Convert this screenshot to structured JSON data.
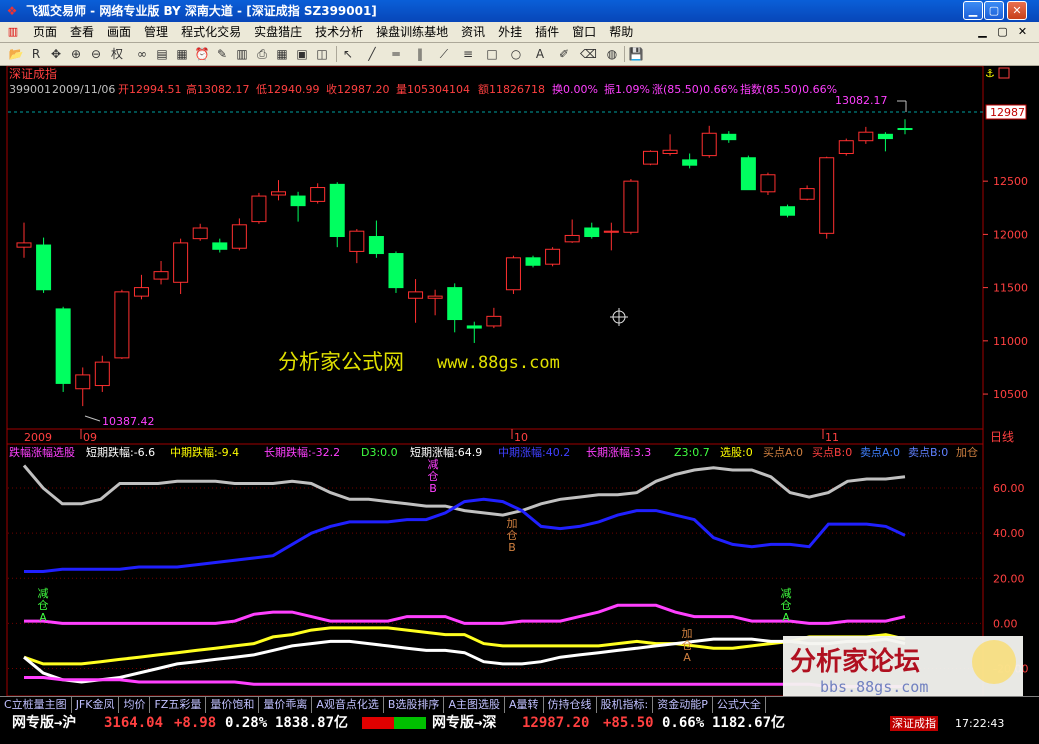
{
  "window": {
    "title": "飞狐交易师 - 网络专业版 BY 深南大道 - [深证成指 SZ399001]",
    "minimize": "▁",
    "maximize": "▢",
    "close": "✕"
  },
  "menu": [
    "页面",
    "查看",
    "画面",
    "管理",
    "程式化交易",
    "实盘猎庄",
    "技术分析",
    "操盘训练基地",
    "资讯",
    "外挂",
    "插件",
    "窗口",
    "帮助"
  ],
  "menu_window_controls": [
    "▁",
    "▢",
    "✕"
  ],
  "toolbar_icons": [
    "folder-icon",
    "rsi-icon",
    "move-icon",
    "zoom-in-icon",
    "zoom-out-icon",
    "link-icon",
    "layout-icon",
    "chart-icon",
    "alarm-icon",
    "tool-icon",
    "stats-icon",
    "print-icon",
    "grid-icon",
    "window-icon",
    "stack-icon",
    "cursor-icon",
    "line-icon",
    "hline-icon",
    "channel-icon",
    "fan-icon",
    "fib-icon",
    "rect-icon",
    "ellipse-icon",
    "text-icon",
    "brush-icon",
    "eraser-icon",
    "palette-icon",
    "save-icon"
  ],
  "toolbar": {
    "quanxuan": "权"
  },
  "price_panel": {
    "name": "深证成指",
    "info_code": "399001",
    "info_date": "2009/11/06",
    "info_open": "开12994.51",
    "info_high": "高13082.17",
    "info_low": "低12940.99",
    "info_close": "收12987.20",
    "info_vol": "量105304104",
    "info_amt": "额11826718",
    "info_turn": "换0.00%",
    "info_amp": "振1.09%",
    "info_chg": "涨(85.50)0.66%",
    "info_idx": "指数(85.50)0.66%",
    "high_label": "13082.17",
    "low_label": "10387.42",
    "current_price": "12987",
    "watermark": "分析家公式网",
    "watermark_url": "www.88gs.com",
    "x_labels": [
      "2009",
      "09",
      "10",
      "11"
    ],
    "period": "日线",
    "y_ticks": [
      "12500",
      "12000",
      "11500",
      "11000",
      "10500"
    ],
    "up_color": "#ff3030",
    "down_color": "#00ff60"
  },
  "indicator_panel": {
    "name": "跌幅涨幅选股",
    "s_drop": "短期跌幅:-6.6",
    "m_drop": "中期跌幅:-9.4",
    "l_drop": "长期跌幅:-32.2",
    "d3": "D3:0.0",
    "s_rise": "短期涨幅:64.9",
    "m_rise": "中期涨幅:40.2",
    "l_rise": "长期涨幅:3.3",
    "z3": "Z3:0.7",
    "xuangu": "选股:0",
    "sell_a": "买点A:0",
    "sell_b": "买点B:0",
    "buy_a": "卖点A:0",
    "buy_b": "卖点B:0",
    "more": "加仓",
    "y_ticks": [
      "60.00",
      "40.00",
      "20.00",
      "0.00",
      "-20.00"
    ],
    "marks": [
      {
        "text": "减仓B",
        "color": "#ff40ff"
      },
      {
        "text": "加仓B",
        "color": "#d08040"
      },
      {
        "text": "减仓A",
        "color": "#40ff40"
      },
      {
        "text": "减仓A",
        "color": "#40ff40"
      },
      {
        "text": "加仓A",
        "color": "#d08040"
      }
    ]
  },
  "ad_logo": {
    "text": "分析家论坛",
    "url": "bbs.88gs.com",
    "time": "17:22:43"
  },
  "status_tabs": [
    "C立桩量主图",
    "JFK金凤",
    "均价",
    "FZ五彩量",
    "量价饱和",
    "量价乖离",
    "A观音点化选",
    "B选股排序",
    "A主图选股",
    "A量转",
    "仿持仓线",
    "股机指标:",
    "资金动能P",
    "公式大全"
  ],
  "quotes": {
    "sh_label": "网专版→沪",
    "sh_price": "3164.04",
    "sh_chg": "+8.98",
    "sh_pct": "0.28%",
    "sh_amt": "1838.87亿",
    "sz_label": "网专版→深",
    "sz_price": "12987.20",
    "sz_chg": "+85.50",
    "sz_pct": "0.66%",
    "sz_amt": "1182.67亿",
    "current_tab": "深证成指"
  },
  "chart_data": {
    "type": "candlestick",
    "title": "深证成指",
    "ylim": [
      10200,
      13300
    ],
    "candles": [
      {
        "o": 11880,
        "c": 11920,
        "h": 12110,
        "l": 11780
      },
      {
        "o": 11900,
        "c": 11480,
        "h": 11970,
        "l": 11450
      },
      {
        "o": 11300,
        "c": 10600,
        "h": 11320,
        "l": 10520
      },
      {
        "o": 10550,
        "c": 10680,
        "h": 10750,
        "l": 10387
      },
      {
        "o": 10580,
        "c": 10800,
        "h": 10860,
        "l": 10520
      },
      {
        "o": 10840,
        "c": 11460,
        "h": 11480,
        "l": 10830
      },
      {
        "o": 11420,
        "c": 11500,
        "h": 11620,
        "l": 11390
      },
      {
        "o": 11580,
        "c": 11650,
        "h": 11750,
        "l": 11530
      },
      {
        "o": 11550,
        "c": 11920,
        "h": 11960,
        "l": 11440
      },
      {
        "o": 11960,
        "c": 12060,
        "h": 12100,
        "l": 11940
      },
      {
        "o": 11920,
        "c": 11860,
        "h": 11960,
        "l": 11830
      },
      {
        "o": 11870,
        "c": 12090,
        "h": 12150,
        "l": 11850
      },
      {
        "o": 12120,
        "c": 12360,
        "h": 12390,
        "l": 12100
      },
      {
        "o": 12370,
        "c": 12400,
        "h": 12510,
        "l": 12320
      },
      {
        "o": 12360,
        "c": 12270,
        "h": 12400,
        "l": 12120
      },
      {
        "o": 12310,
        "c": 12440,
        "h": 12480,
        "l": 12290
      },
      {
        "o": 12470,
        "c": 11980,
        "h": 12490,
        "l": 11880
      },
      {
        "o": 11840,
        "c": 12030,
        "h": 12050,
        "l": 11730
      },
      {
        "o": 11980,
        "c": 11820,
        "h": 12130,
        "l": 11780
      },
      {
        "o": 11820,
        "c": 11500,
        "h": 11840,
        "l": 11450
      },
      {
        "o": 11400,
        "c": 11460,
        "h": 11580,
        "l": 11170
      },
      {
        "o": 11400,
        "c": 11420,
        "h": 11480,
        "l": 11240
      },
      {
        "o": 11500,
        "c": 11200,
        "h": 11540,
        "l": 11080
      },
      {
        "o": 11140,
        "c": 11120,
        "h": 11180,
        "l": 10980
      },
      {
        "o": 11140,
        "c": 11230,
        "h": 11310,
        "l": 11120
      },
      {
        "o": 11480,
        "c": 11780,
        "h": 11800,
        "l": 11440
      },
      {
        "o": 11780,
        "c": 11710,
        "h": 11800,
        "l": 11690
      },
      {
        "o": 11720,
        "c": 11860,
        "h": 11880,
        "l": 11700
      },
      {
        "o": 11930,
        "c": 11990,
        "h": 12140,
        "l": 11920
      },
      {
        "o": 12060,
        "c": 11980,
        "h": 12110,
        "l": 11960
      },
      {
        "o": 12020,
        "c": 12030,
        "h": 12110,
        "l": 11850
      },
      {
        "o": 12020,
        "c": 12500,
        "h": 12520,
        "l": 12000
      },
      {
        "o": 12660,
        "c": 12780,
        "h": 12790,
        "l": 12650
      },
      {
        "o": 12760,
        "c": 12790,
        "h": 12940,
        "l": 12740
      },
      {
        "o": 12700,
        "c": 12650,
        "h": 12760,
        "l": 12620
      },
      {
        "o": 12740,
        "c": 12950,
        "h": 13020,
        "l": 12720
      },
      {
        "o": 12940,
        "c": 12890,
        "h": 12970,
        "l": 12860
      },
      {
        "o": 12720,
        "c": 12420,
        "h": 12740,
        "l": 12420
      },
      {
        "o": 12400,
        "c": 12560,
        "h": 12580,
        "l": 12370
      },
      {
        "o": 12260,
        "c": 12180,
        "h": 12280,
        "l": 12160
      },
      {
        "o": 12330,
        "c": 12430,
        "h": 12460,
        "l": 12320
      },
      {
        "o": 12010,
        "c": 12720,
        "h": 12730,
        "l": 11960
      },
      {
        "o": 12760,
        "c": 12880,
        "h": 12900,
        "l": 12740
      },
      {
        "o": 12880,
        "c": 12960,
        "h": 13010,
        "l": 12850
      },
      {
        "o": 12940,
        "c": 12900,
        "h": 12960,
        "l": 12780
      },
      {
        "o": 12994.51,
        "c": 12987.2,
        "h": 13082.17,
        "l": 12940.99
      }
    ],
    "indicator": {
      "ylim": [
        -30,
        72
      ],
      "series": [
        {
          "color": "#c0c0c0",
          "values": [
            70,
            60,
            53,
            53,
            55,
            62,
            62,
            62,
            63,
            63,
            63,
            62,
            62,
            62,
            63,
            62,
            58,
            55,
            55,
            54,
            53,
            52,
            52,
            50,
            49,
            48,
            50,
            53,
            55,
            56,
            57,
            57,
            58,
            63,
            66,
            68,
            69,
            68,
            68,
            65,
            58,
            56,
            58,
            63,
            64,
            64,
            65
          ]
        },
        {
          "color": "#2020ff",
          "values": [
            23,
            23,
            24,
            24,
            24,
            24,
            25,
            25,
            25,
            26,
            27,
            28,
            29,
            30,
            35,
            40,
            43,
            45,
            45,
            45,
            46,
            46,
            49,
            54,
            55,
            54,
            50,
            43,
            42,
            43,
            45,
            48,
            50,
            50,
            48,
            46,
            38,
            35,
            34,
            35,
            35,
            34,
            44,
            44,
            44,
            43,
            39
          ]
        },
        {
          "color": "#ff40ff",
          "values": [
            1,
            1,
            0,
            0,
            0,
            0,
            0,
            0,
            0,
            0,
            0,
            1,
            4,
            5,
            5,
            3,
            1,
            1,
            1,
            1,
            3,
            3,
            3,
            0,
            0,
            0,
            1,
            1,
            1,
            3,
            5,
            8,
            8,
            8,
            5,
            3,
            3,
            3,
            1,
            1,
            1,
            0,
            0,
            1,
            1,
            1,
            3
          ]
        },
        {
          "color": "#ffff20",
          "values": [
            -15,
            -18,
            -18,
            -18,
            -17,
            -16,
            -15,
            -14,
            -13,
            -12,
            -11,
            -10,
            -9,
            -6,
            -5,
            -3,
            -2,
            -2,
            -2,
            -2,
            -3,
            -4,
            -5,
            -5,
            -9,
            -10,
            -10,
            -10,
            -10,
            -10,
            -10,
            -9,
            -8,
            -9,
            -9,
            -10,
            -11,
            -11,
            -10,
            -9,
            -8,
            -6,
            -6,
            -6,
            -6,
            -5,
            -7
          ]
        },
        {
          "color": "#ffffff",
          "values": [
            -15,
            -22,
            -25,
            -26,
            -25,
            -24,
            -22,
            -20,
            -18,
            -17,
            -16,
            -15,
            -14,
            -12,
            -10,
            -9,
            -8,
            -8,
            -9,
            -10,
            -11,
            -12,
            -12,
            -13,
            -17,
            -18,
            -18,
            -17,
            -15,
            -14,
            -13,
            -12,
            -11,
            -10,
            -9,
            -8,
            -7,
            -7,
            -7,
            -8,
            -8,
            -9,
            -9,
            -8,
            -8,
            -7,
            -9
          ]
        },
        {
          "color": "#ff40ff",
          "values": [
            -24,
            -24,
            -25,
            -25,
            -25,
            -25,
            -26,
            -26,
            -26,
            -26,
            -26,
            -26,
            -27,
            -27,
            -27,
            -27,
            -27,
            -27,
            -27,
            -27,
            -27,
            -27,
            -27,
            -27,
            -27,
            -27,
            -27,
            -27,
            -27,
            -27,
            -27,
            -27,
            -27,
            -27,
            -27,
            -27,
            -27,
            -27,
            -27,
            -27,
            -27,
            -27,
            -28,
            -28,
            -28,
            -28,
            -28
          ]
        }
      ]
    }
  }
}
